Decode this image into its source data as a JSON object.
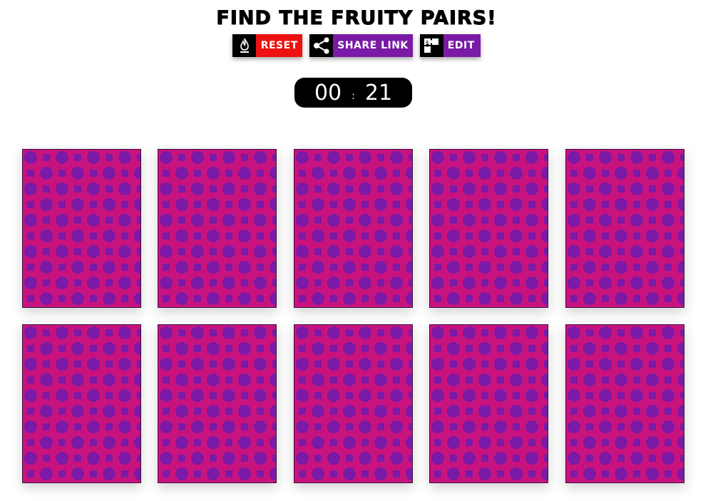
{
  "title": "FIND THE FRUITY PAIRS!",
  "toolbar": {
    "reset": {
      "label": "RESET",
      "icon": "fire-icon",
      "color": "#ee1111"
    },
    "share": {
      "label": "SHARE LINK",
      "icon": "share-icon",
      "color": "#7a1aa6"
    },
    "edit": {
      "label": "EDIT",
      "icon": "puzzle-edit-icon",
      "color": "#7a1aa6"
    }
  },
  "timer": {
    "minutes": "00",
    "separator": ":",
    "seconds": "21"
  },
  "board": {
    "card_back_colors": {
      "base": "#c8137e",
      "pattern": "#7a1aa6"
    },
    "cards": [
      {
        "state": "face-down"
      },
      {
        "state": "face-down"
      },
      {
        "state": "face-down"
      },
      {
        "state": "face-down"
      },
      {
        "state": "face-down"
      },
      {
        "state": "face-down"
      },
      {
        "state": "face-down"
      },
      {
        "state": "face-down"
      },
      {
        "state": "face-down"
      },
      {
        "state": "face-down"
      }
    ]
  }
}
